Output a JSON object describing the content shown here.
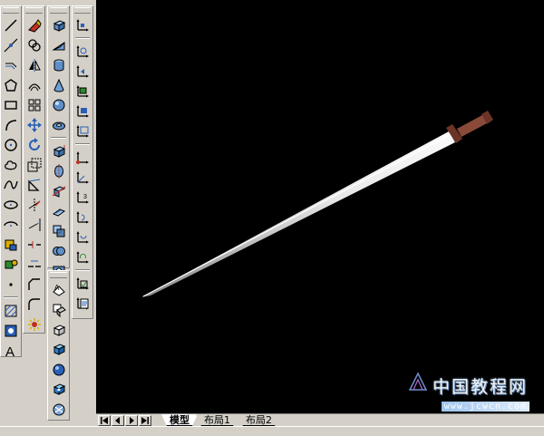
{
  "toolbars": {
    "draw": {
      "name": "draw-toolbar",
      "buttons": [
        {
          "name": "line-icon",
          "g": "line"
        },
        {
          "name": "construction-line-icon",
          "g": "xline"
        },
        {
          "name": "multiline-icon",
          "g": "mline"
        },
        {
          "name": "polygon-icon",
          "g": "polygon"
        },
        {
          "name": "rectangle-icon",
          "g": "rect"
        },
        {
          "name": "arc-icon",
          "g": "arc"
        },
        {
          "name": "circle-icon",
          "g": "circle"
        },
        {
          "name": "revision-cloud-icon",
          "g": "cloud"
        },
        {
          "name": "spline-icon",
          "g": "spline"
        },
        {
          "name": "ellipse-icon",
          "g": "ellipse"
        },
        {
          "name": "ellipse-arc-icon",
          "g": "ellarc"
        },
        {
          "name": "insert-block-icon",
          "g": "block"
        },
        {
          "name": "make-block-icon",
          "g": "makeblock"
        },
        {
          "name": "point-icon",
          "g": "point"
        },
        {
          "name": "hatch-icon",
          "g": "hatch"
        },
        {
          "name": "region-icon",
          "g": "region"
        },
        {
          "name": "multiline-text-icon",
          "g": "text"
        }
      ]
    },
    "modify": {
      "name": "modify-toolbar",
      "buttons": [
        {
          "name": "erase-icon",
          "g": "erase"
        },
        {
          "name": "copy-icon",
          "g": "copy"
        },
        {
          "name": "mirror-icon",
          "g": "mirror"
        },
        {
          "name": "offset-icon",
          "g": "offset"
        },
        {
          "name": "array-icon",
          "g": "array"
        },
        {
          "name": "move-icon",
          "g": "move"
        },
        {
          "name": "rotate-icon",
          "g": "rotate"
        },
        {
          "name": "scale-icon",
          "g": "scale"
        },
        {
          "name": "stretch-icon",
          "g": "stretch"
        },
        {
          "name": "trim-icon",
          "g": "trim"
        },
        {
          "name": "extend-icon",
          "g": "extend"
        },
        {
          "name": "break-icon",
          "g": "break"
        },
        {
          "name": "join-icon",
          "g": "join"
        },
        {
          "name": "chamfer-icon",
          "g": "chamfer"
        },
        {
          "name": "fillet-icon",
          "g": "fillet"
        },
        {
          "name": "explode-icon",
          "g": "explode"
        }
      ]
    },
    "solids": {
      "name": "solids-toolbar",
      "buttons": [
        {
          "name": "solid-box-icon",
          "g": "box"
        },
        {
          "name": "solid-wedge-icon",
          "g": "wedge"
        },
        {
          "name": "solid-cylinder-icon",
          "g": "cyl"
        },
        {
          "name": "solid-cone-icon",
          "g": "cone"
        },
        {
          "name": "solid-sphere-icon",
          "g": "sph"
        },
        {
          "name": "solid-torus-icon",
          "g": "torus"
        },
        {
          "name": "solid-extrude-icon",
          "g": "extrude"
        },
        {
          "name": "solid-revolve-icon",
          "g": "revolve"
        },
        {
          "name": "solid-slice-icon",
          "g": "slice"
        },
        {
          "name": "solid-section-icon",
          "g": "section"
        },
        {
          "name": "solid-interfere-icon",
          "g": "interfere"
        },
        {
          "name": "solid-union-icon",
          "g": "union"
        },
        {
          "name": "solid-subtract-icon",
          "g": "subtract"
        },
        {
          "name": "binoculars-icon",
          "g": "binoculars"
        }
      ]
    },
    "render": {
      "name": "render-toolbar",
      "buttons": [
        {
          "name": "hide-icon",
          "g": "hide"
        },
        {
          "name": "render-icon",
          "g": "render"
        },
        {
          "name": "scenes-icon",
          "g": "scenes"
        },
        {
          "name": "lights-icon",
          "g": "lights"
        },
        {
          "name": "materials-icon",
          "g": "materials"
        },
        {
          "name": "materials-library-icon",
          "g": "matlib"
        },
        {
          "name": "background-icon",
          "g": "bg"
        }
      ]
    },
    "ucs": {
      "name": "ucs-toolbar",
      "buttons": [
        {
          "name": "ucs-icon",
          "g": "ucs"
        },
        {
          "name": "ucs-world-icon",
          "g": "ucsworld"
        },
        {
          "name": "ucs-previous-icon",
          "g": "ucsprev"
        },
        {
          "name": "ucs-face-icon",
          "g": "ucsface"
        },
        {
          "name": "ucs-object-icon",
          "g": "ucsobj"
        },
        {
          "name": "ucs-view-icon",
          "g": "ucsview"
        },
        {
          "name": "ucs-origin-icon",
          "g": "ucsorigin"
        },
        {
          "name": "ucs-zaxis-icon",
          "g": "ucsz"
        },
        {
          "name": "ucs-3point-icon",
          "g": "ucs3"
        },
        {
          "name": "ucs-x-icon",
          "g": "ucsx"
        },
        {
          "name": "ucs-y-icon",
          "g": "ucsy"
        },
        {
          "name": "ucs-z-icon",
          "g": "ucszr"
        },
        {
          "name": "ucs-apply-icon",
          "g": "ucsapply"
        },
        {
          "name": "named-ucs-icon",
          "g": "ucsnamed"
        }
      ]
    }
  },
  "viewport": {
    "background": "#000000",
    "object": "sword-model"
  },
  "tabs": [
    {
      "label": "模型",
      "active": true
    },
    {
      "label": "布局1",
      "active": false
    },
    {
      "label": "布局2",
      "active": false
    }
  ],
  "nav_buttons": [
    "first-layout-icon",
    "previous-layout-icon",
    "next-layout-icon",
    "last-layout-icon"
  ],
  "watermark": {
    "title": "中国教程网",
    "url": "www.jcwcn.com"
  }
}
